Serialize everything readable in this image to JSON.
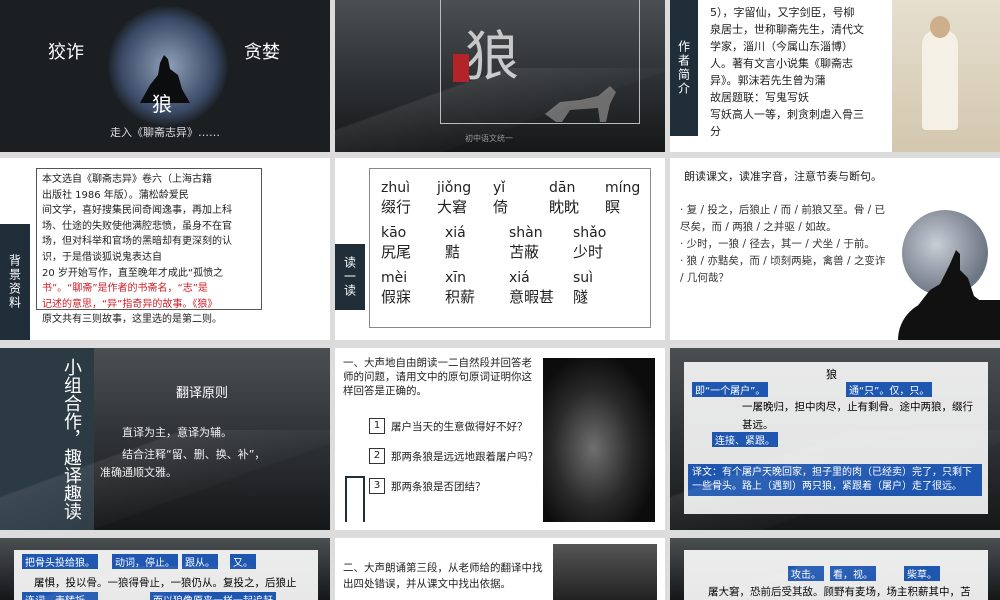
{
  "s1": {
    "left": "狡诈",
    "right": "贪婪",
    "center": "狼",
    "caption": "走入《聊斋志异》……"
  },
  "s2": {
    "title": "狼",
    "tag": "初中语文统一"
  },
  "s3": {
    "lines": [
      "5），字留仙，又字剑臣，号柳",
      "泉居士，世称聊斋先生，清代文",
      "学家，淄川（今属山东淄博）",
      "人。著有文言小说集《聊斋志",
      "异》。郭沫若先生曾为蒲",
      "故居题联：写鬼写妖",
      "写妖高人一等，刺贪刺虐入骨三",
      "分"
    ],
    "tab": "作者简介"
  },
  "s4": {
    "lines": [
      "本文选自《聊斋志异》卷六（上海古籍",
      "出版社 1986 年版）。蒲松龄爱民",
      "间文学，喜好搜集民间奇闻逸事，再加上科",
      "场、仕途的失败使他满腔悲愤，虽身不在官",
      "场，但对科举和官场的黑暗却有更深刻的认",
      "识，于是借谈狐说鬼表达自",
      "20 岁开始写作，直至晚年才成此“孤愤之",
      "书”。“聊斋”是作者的书斋名，“志”是",
      "记述的意思，“异”指奇异的故事。《狼》",
      "原文共有三则故事，这里选的是第二则。"
    ],
    "tab": "背景资料"
  },
  "s5": {
    "tab": "读一读",
    "row1": [
      {
        "py": "zhuì",
        "w": "缀行"
      },
      {
        "py": "jiǒng",
        "w": "大窘"
      },
      {
        "py": "yǐ",
        "w": "倚"
      },
      {
        "py": "dān",
        "w": "眈眈"
      },
      {
        "py": "míng",
        "w": "瞑"
      }
    ],
    "row2": [
      {
        "py": "kāo",
        "w": "尻尾"
      },
      {
        "py": "xiá",
        "w": "黠"
      },
      {
        "py": "shàn",
        "w": "苫蔽"
      },
      {
        "py": "shǎo",
        "w": "少时"
      }
    ],
    "row3": [
      {
        "py": "mèi",
        "w": "假寐"
      },
      {
        "py": "xīn",
        "w": "积薪"
      },
      {
        "py": "xiá",
        "w": "意暇甚"
      },
      {
        "py": "suì",
        "w": "隧"
      }
    ]
  },
  "s6": {
    "head": "朗读课文，读准字音，注意节奏与断句。",
    "lines": [
      "· 复 / 投之，后狼止 / 而 / 前狼又至。骨 / 已",
      "尽矣，而 / 两狼 / 之并驱 / 如故。",
      "· 少时，一狼 / 径去，其一 / 犬坐 / 于前。",
      "· 狼 / 亦黠矣，而 / 顷刻两毙，禽兽 / 之变诈",
      "/ 几何哉？"
    ]
  },
  "s7": {
    "tab": "小组合作，趣译趣读",
    "title": "翻译原则",
    "p1": "直译为主，意译为辅。",
    "p2": "结合注释“留、删、换、补”，",
    "p3": "准确通顺文雅。"
  },
  "s8": {
    "intro": "一、大声地自由朗读一二自然段并回答老师的问题，请用文中的原句原词证明你这样回答是正确的。",
    "q": [
      {
        "n": "1",
        "t": "屠户当天的生意做得好不好？"
      },
      {
        "n": "2",
        "t": "那两条狼是远远地跟着屠户吗？"
      },
      {
        "n": "3",
        "t": "那两条狼是否团结？"
      }
    ]
  },
  "s9": {
    "title": "狼",
    "notes": [
      "即“一个屠户”。",
      "通“只”。仅，只。",
      "连接、紧跟。"
    ],
    "text": "一屠晚归，担中肉尽，止有剩骨。途中两狼，缀行甚远。",
    "translation": "译文：有个屠户天晚回家，担子里的肉（已经卖）完了，只剩下一些骨头。路上（遇到）两只狼，紧跟着（屠户）走了很远。"
  },
  "s10": {
    "notes": [
      "把骨头投给狼。",
      "动词，停止。",
      "跟从。",
      "又。"
    ],
    "text": "屠惧，投以骨。一狼得骨止，一狼仍从。复投之，后狼止",
    "notes2": [
      "连词，表转折。",
      "而以狼像原来一样一起追赶"
    ]
  },
  "s11": {
    "text": "二、大声朗诵第三段，从老师给的翻译中找出四处错误，并从课文中找出依据。"
  },
  "s12": {
    "notes": [
      "攻击。",
      "看，视。",
      "柴草。"
    ],
    "text": "屠大窘，恐前后受其敌。顾野有麦场，场主积薪其中，苫"
  }
}
